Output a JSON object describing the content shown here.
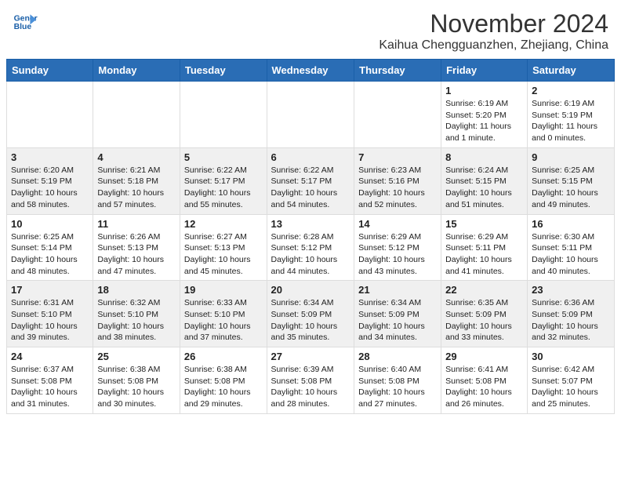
{
  "header": {
    "logo_line1": "General",
    "logo_line2": "Blue",
    "month": "November 2024",
    "location": "Kaihua Chengguanzhen, Zhejiang, China"
  },
  "days_of_week": [
    "Sunday",
    "Monday",
    "Tuesday",
    "Wednesday",
    "Thursday",
    "Friday",
    "Saturday"
  ],
  "weeks": [
    [
      {
        "day": "",
        "info": ""
      },
      {
        "day": "",
        "info": ""
      },
      {
        "day": "",
        "info": ""
      },
      {
        "day": "",
        "info": ""
      },
      {
        "day": "",
        "info": ""
      },
      {
        "day": "1",
        "info": "Sunrise: 6:19 AM\nSunset: 5:20 PM\nDaylight: 11 hours\nand 1 minute."
      },
      {
        "day": "2",
        "info": "Sunrise: 6:19 AM\nSunset: 5:19 PM\nDaylight: 11 hours\nand 0 minutes."
      }
    ],
    [
      {
        "day": "3",
        "info": "Sunrise: 6:20 AM\nSunset: 5:19 PM\nDaylight: 10 hours\nand 58 minutes."
      },
      {
        "day": "4",
        "info": "Sunrise: 6:21 AM\nSunset: 5:18 PM\nDaylight: 10 hours\nand 57 minutes."
      },
      {
        "day": "5",
        "info": "Sunrise: 6:22 AM\nSunset: 5:17 PM\nDaylight: 10 hours\nand 55 minutes."
      },
      {
        "day": "6",
        "info": "Sunrise: 6:22 AM\nSunset: 5:17 PM\nDaylight: 10 hours\nand 54 minutes."
      },
      {
        "day": "7",
        "info": "Sunrise: 6:23 AM\nSunset: 5:16 PM\nDaylight: 10 hours\nand 52 minutes."
      },
      {
        "day": "8",
        "info": "Sunrise: 6:24 AM\nSunset: 5:15 PM\nDaylight: 10 hours\nand 51 minutes."
      },
      {
        "day": "9",
        "info": "Sunrise: 6:25 AM\nSunset: 5:15 PM\nDaylight: 10 hours\nand 49 minutes."
      }
    ],
    [
      {
        "day": "10",
        "info": "Sunrise: 6:25 AM\nSunset: 5:14 PM\nDaylight: 10 hours\nand 48 minutes."
      },
      {
        "day": "11",
        "info": "Sunrise: 6:26 AM\nSunset: 5:13 PM\nDaylight: 10 hours\nand 47 minutes."
      },
      {
        "day": "12",
        "info": "Sunrise: 6:27 AM\nSunset: 5:13 PM\nDaylight: 10 hours\nand 45 minutes."
      },
      {
        "day": "13",
        "info": "Sunrise: 6:28 AM\nSunset: 5:12 PM\nDaylight: 10 hours\nand 44 minutes."
      },
      {
        "day": "14",
        "info": "Sunrise: 6:29 AM\nSunset: 5:12 PM\nDaylight: 10 hours\nand 43 minutes."
      },
      {
        "day": "15",
        "info": "Sunrise: 6:29 AM\nSunset: 5:11 PM\nDaylight: 10 hours\nand 41 minutes."
      },
      {
        "day": "16",
        "info": "Sunrise: 6:30 AM\nSunset: 5:11 PM\nDaylight: 10 hours\nand 40 minutes."
      }
    ],
    [
      {
        "day": "17",
        "info": "Sunrise: 6:31 AM\nSunset: 5:10 PM\nDaylight: 10 hours\nand 39 minutes."
      },
      {
        "day": "18",
        "info": "Sunrise: 6:32 AM\nSunset: 5:10 PM\nDaylight: 10 hours\nand 38 minutes."
      },
      {
        "day": "19",
        "info": "Sunrise: 6:33 AM\nSunset: 5:10 PM\nDaylight: 10 hours\nand 37 minutes."
      },
      {
        "day": "20",
        "info": "Sunrise: 6:34 AM\nSunset: 5:09 PM\nDaylight: 10 hours\nand 35 minutes."
      },
      {
        "day": "21",
        "info": "Sunrise: 6:34 AM\nSunset: 5:09 PM\nDaylight: 10 hours\nand 34 minutes."
      },
      {
        "day": "22",
        "info": "Sunrise: 6:35 AM\nSunset: 5:09 PM\nDaylight: 10 hours\nand 33 minutes."
      },
      {
        "day": "23",
        "info": "Sunrise: 6:36 AM\nSunset: 5:09 PM\nDaylight: 10 hours\nand 32 minutes."
      }
    ],
    [
      {
        "day": "24",
        "info": "Sunrise: 6:37 AM\nSunset: 5:08 PM\nDaylight: 10 hours\nand 31 minutes."
      },
      {
        "day": "25",
        "info": "Sunrise: 6:38 AM\nSunset: 5:08 PM\nDaylight: 10 hours\nand 30 minutes."
      },
      {
        "day": "26",
        "info": "Sunrise: 6:38 AM\nSunset: 5:08 PM\nDaylight: 10 hours\nand 29 minutes."
      },
      {
        "day": "27",
        "info": "Sunrise: 6:39 AM\nSunset: 5:08 PM\nDaylight: 10 hours\nand 28 minutes."
      },
      {
        "day": "28",
        "info": "Sunrise: 6:40 AM\nSunset: 5:08 PM\nDaylight: 10 hours\nand 27 minutes."
      },
      {
        "day": "29",
        "info": "Sunrise: 6:41 AM\nSunset: 5:08 PM\nDaylight: 10 hours\nand 26 minutes."
      },
      {
        "day": "30",
        "info": "Sunrise: 6:42 AM\nSunset: 5:07 PM\nDaylight: 10 hours\nand 25 minutes."
      }
    ]
  ]
}
